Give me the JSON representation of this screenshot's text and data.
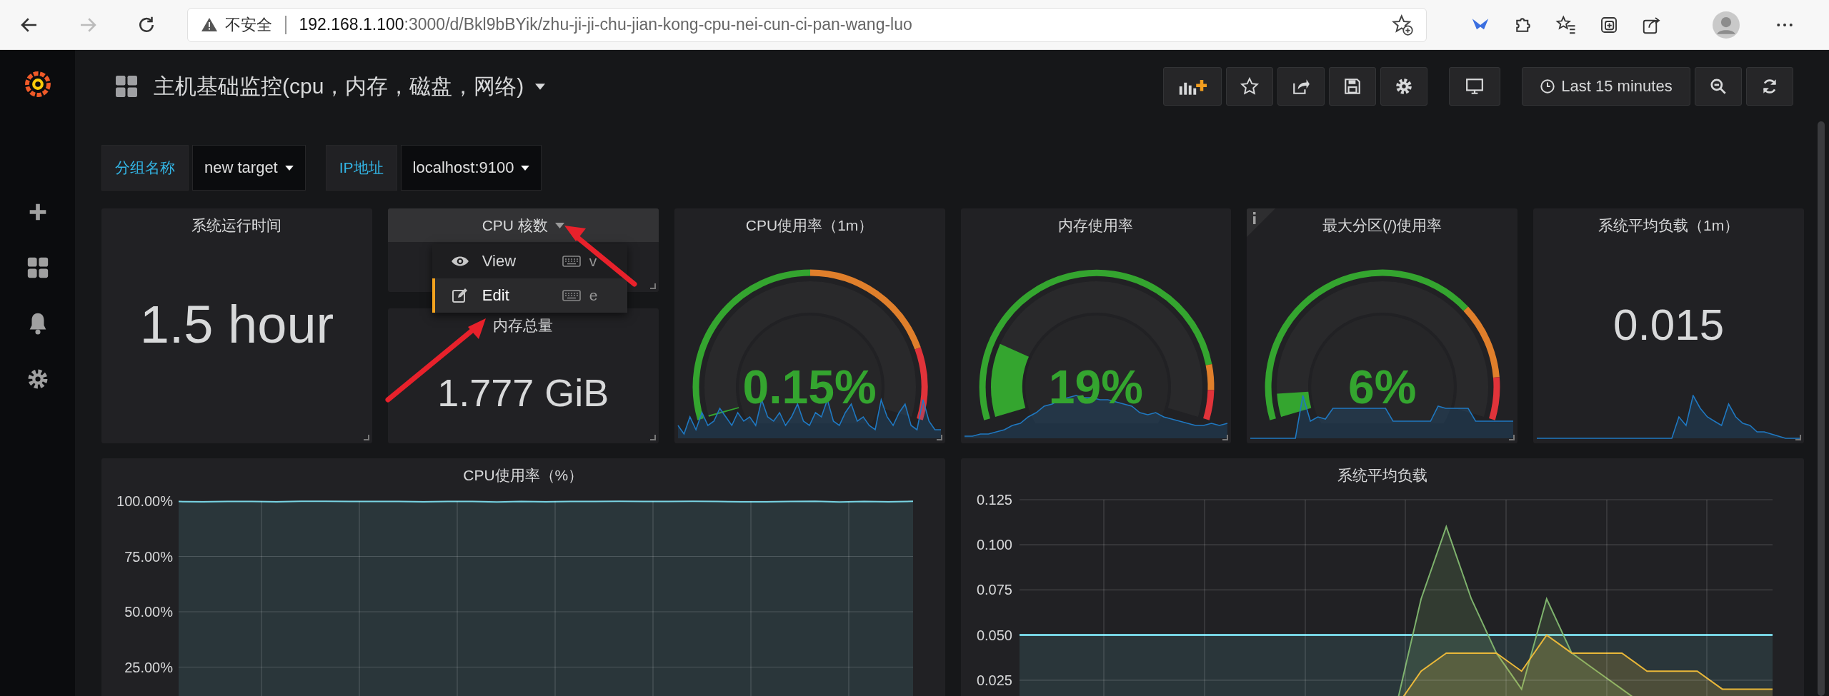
{
  "browser": {
    "security_label": "不安全",
    "url": {
      "host": "192.168.1.100",
      "rest": ":3000/d/Bkl9bBYik/zhu-ji-ji-chu-jian-kong-cpu-nei-cun-ci-pan-wang-luo"
    }
  },
  "dashboard": {
    "title": "主机基础监控(cpu，内存，磁盘，网络)",
    "time_range": "Last 15 minutes"
  },
  "variables": [
    {
      "label": "分组名称",
      "value": "new target"
    },
    {
      "label": "IP地址",
      "value": "localhost:9100"
    }
  ],
  "panels": [
    {
      "kind": "stat",
      "title": "系统运行时间",
      "value": "1.5 hour",
      "sparkline": false
    },
    {
      "kind": "stack",
      "children": [
        {
          "kind": "header",
          "title": "CPU 核数",
          "menu": {
            "items": [
              {
                "label": "View",
                "shortcut": "v",
                "selected": false
              },
              {
                "label": "Edit",
                "shortcut": "e",
                "selected": true
              }
            ]
          }
        },
        {
          "kind": "stat",
          "title": "内存总量",
          "value": "1.777 GiB",
          "sparkline": false
        }
      ]
    },
    {
      "kind": "gauge",
      "title": "CPU使用率（1m）",
      "value": "0.15%",
      "info": false
    },
    {
      "kind": "gauge",
      "title": "内存使用率",
      "value": "19%",
      "info": false
    },
    {
      "kind": "gauge",
      "title": "最大分区(/)使用率",
      "value": "6%",
      "info": true
    },
    {
      "kind": "stat",
      "title": "系统平均负载（1m）",
      "value": "0.015",
      "sparkline": true
    }
  ],
  "graphs": [
    {
      "title": "CPU使用率（%）",
      "chart_data": {
        "type": "area",
        "grid": true,
        "ylim": [
          0,
          100
        ],
        "yticks": [
          {
            "value": 25,
            "label": "25.00%"
          },
          {
            "value": 50,
            "label": "50.00%"
          },
          {
            "value": 75,
            "label": "75.00%"
          },
          {
            "value": 100,
            "label": "100.00%"
          }
        ],
        "series": [
          {
            "color": "#6ed0e0",
            "values": [
              99.8,
              99.7,
              99.8,
              99.8,
              99.7,
              99.9,
              99.9,
              99.8,
              99.8,
              99.8,
              99.7,
              99.8,
              99.8,
              99.6,
              99.8,
              99.7,
              99.8,
              99.8,
              99.9,
              99.8,
              99.8,
              99.9,
              99.8,
              99.7,
              99.7,
              99.8,
              99.9,
              99.6,
              99.8,
              99.7,
              99.9
            ]
          }
        ]
      }
    },
    {
      "title": "系统平均负载",
      "chart_data": {
        "type": "area",
        "grid": true,
        "ylim": [
          0,
          0.125
        ],
        "yticks": [
          {
            "value": 0.025,
            "label": "0.025"
          },
          {
            "value": 0.05,
            "label": "0.050"
          },
          {
            "value": 0.075,
            "label": "0.075"
          },
          {
            "value": 0.1,
            "label": "0.100"
          },
          {
            "value": 0.125,
            "label": "0.125"
          }
        ],
        "series": [
          {
            "color": "#6ed0e0",
            "values": [
              0.05,
              0.05,
              0.05,
              0.05,
              0.05,
              0.05,
              0.05,
              0.05,
              0.05,
              0.05,
              0.05,
              0.05,
              0.05,
              0.05,
              0.05,
              0.05,
              0.05,
              0.05,
              0.05,
              0.05,
              0.05,
              0.05,
              0.05,
              0.05,
              0.05,
              0.05,
              0.05,
              0.05,
              0.05,
              0.05,
              0.05
            ]
          },
          {
            "color": "#7eb26d",
            "values": [
              null,
              null,
              null,
              null,
              null,
              null,
              null,
              null,
              null,
              null,
              null,
              null,
              null,
              null,
              null,
              0.01,
              0.07,
              0.11,
              0.07,
              0.04,
              0.02,
              0.07,
              0.04,
              0.03,
              0.02,
              0.01,
              0.01,
              0.01,
              0.01,
              0.01,
              0.01
            ]
          },
          {
            "color": "#eab839",
            "values": [
              null,
              null,
              null,
              null,
              null,
              null,
              null,
              null,
              null,
              null,
              null,
              null,
              null,
              null,
              null,
              0.01,
              0.03,
              0.04,
              0.04,
              0.04,
              0.03,
              0.05,
              0.04,
              0.04,
              0.04,
              0.03,
              0.03,
              0.03,
              0.02,
              0.02,
              0.02
            ]
          }
        ]
      }
    }
  ]
}
